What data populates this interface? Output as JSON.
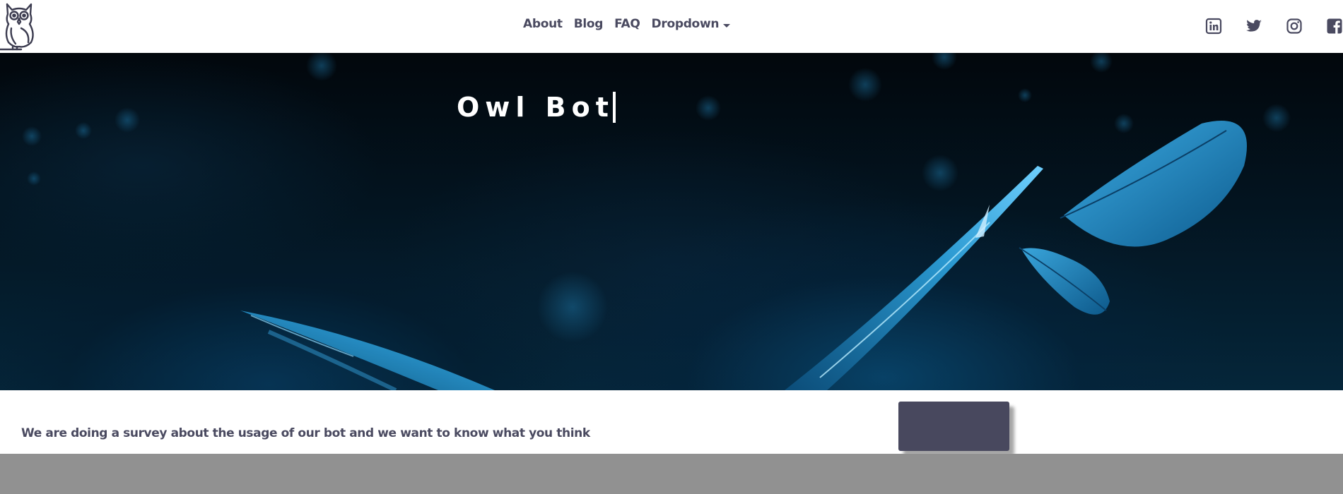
{
  "brand": {
    "logo_icon": "owl-logo-icon"
  },
  "nav": {
    "links": [
      {
        "label": "About"
      },
      {
        "label": "Blog"
      },
      {
        "label": "FAQ"
      }
    ],
    "dropdown": {
      "label": "Dropdown",
      "icon": "caret-down-icon"
    }
  },
  "social": [
    {
      "icon": "linkedin-icon"
    },
    {
      "icon": "twitter-icon"
    },
    {
      "icon": "instagram-icon"
    },
    {
      "icon": "facebook-icon"
    }
  ],
  "hero": {
    "title": "Owl Bot",
    "background": "blue feathers on dark background"
  },
  "survey": {
    "text": "We are doing a survey about the usage of our bot and we want to know what you think",
    "button_label": ""
  },
  "colors": {
    "text": "#4a4a60",
    "button": "#48485e",
    "footer": "#919191",
    "hero_accent": "#1a8fd0"
  }
}
